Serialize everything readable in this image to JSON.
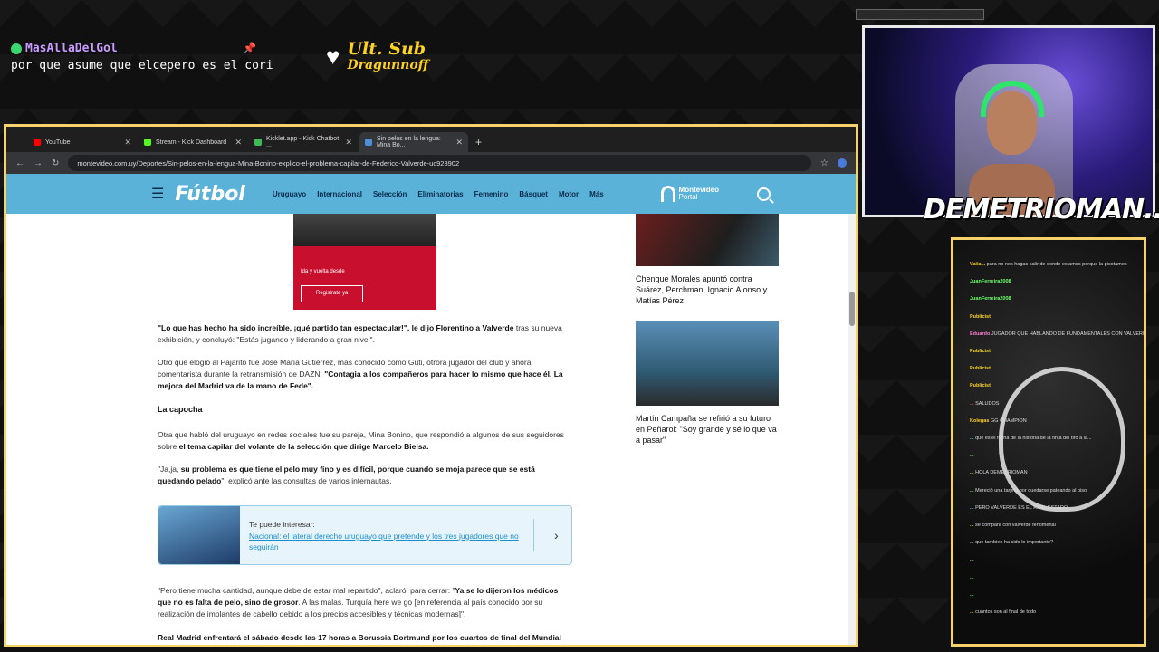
{
  "overlay": {
    "chat_user": "MasAllaDelGol",
    "chat_message": "por que asume que elcepero es el cori",
    "sub_title": "Ult. Sub",
    "sub_name": "Dragunnoff",
    "streamer_name": "DEMETRIOMAN..."
  },
  "browser": {
    "tabs": [
      {
        "label": "YouTube",
        "color": "#ff0000"
      },
      {
        "label": "Stream - Kick Dashboard",
        "color": "#53fc18"
      },
      {
        "label": "Kicklet.app - Kick Chatbot ...",
        "color": "#3cba54"
      },
      {
        "label": "Sin pelos en la lengua: Mina Bo...",
        "color": "#4a90d9"
      }
    ],
    "url": "montevideo.com.uy/Deportes/Sin-pelos-en-la-lengua-Mina-Bonino-explico-el-problema-capilar-de-Federico-Valverde-uc928902"
  },
  "site": {
    "logo": "Fútbol",
    "nav": [
      "Uruguayo",
      "Internacional",
      "Selección",
      "Eliminatorias",
      "Femenino",
      "Básquet",
      "Motor",
      "Más"
    ],
    "portal_line1": "Montevideo",
    "portal_line2": "Portal",
    "ad_text": "Ida y vuelta desde",
    "ad_button": "Registrate ya",
    "p1a": "\"Lo que has hecho ha sido increíble, ¡qué partido tan espectacular!\", le dijo Florentino a Valverde",
    "p1b": " tras su nueva exhibición, y concluyó: \"Estás jugando y liderando a gran nivel\".",
    "p2a": "Otro que elogió al Pajarito fue José María Gutiérrez, más conocido como Guti, otrora jugador del club y ahora comentarista durante la retransmisión de DAZN: ",
    "p2b": "\"Contagia a los compañeros para hacer lo mismo que hace él. La mejora del Madrid va de la mano de Fede\".",
    "heading": "La capocha",
    "p3a": "Otra que habló del uruguayo en redes sociales fue su pareja, Mina Bonino, que respondió a algunos de sus seguidores sobre ",
    "p3b": "el tema capilar del volante de la selección que dirige Marcelo Bielsa.",
    "p4a": "\"Ja,ja, ",
    "p4b": "su problema es que tiene el pelo muy fino y es difícil, porque cuando se moja parece que se está quedando pelado",
    "p4c": "\", explicó ante las consultas de varios internautas.",
    "related_label": "Te puede interesar:",
    "related_link": "Nacional: el lateral derecho uruguayo que pretende y los tres jugadores que no seguirán",
    "p5a": "\"Pero tiene mucha cantidad, aunque debe de estar mal repartido\", aclaró, para cerrar: \"",
    "p5b": "Ya se lo dijeron los médicos que no es falta de pelo, sino de grosor",
    "p5c": ". A las malas. Turquía here we go [en referencia al país conocido por su realización de implantes de cabello debido a los precios accesibles y técnicas modernas]\".",
    "p6": "Real Madrid enfrentará el sábado desde las 17 horas a Borussia Dortmund por los cuartos de final del Mundial en",
    "side1": "Chengue Morales apuntó contra Suárez, Perchman, Ignacio Alonso y Matías Pérez",
    "side2": "Martín Campaña se refirió a su futuro en Peñarol: \"Soy grande y sé lo que va a pasar\""
  },
  "chat": [
    {
      "user": "Vaiia...",
      "text": "para no nos hagas salir de donde estamos porque la picotamos",
      "color": "#ffd21f"
    },
    {
      "user": "JuanFerreira2008",
      "text": "",
      "color": "#6cff6c"
    },
    {
      "user": "JuanFerreira2008",
      "text": "",
      "color": "#6cff6c"
    },
    {
      "user": "Publicist",
      "text": "",
      "color": "#ffd21f"
    },
    {
      "user": "Eduardo",
      "text": "JUGADOR QUE HABLANDO DE FUNDAMENTALES CON VALVERDE DE CAPACIDAD",
      "color": "#ff7bd5"
    },
    {
      "user": "Publicist",
      "text": "",
      "color": "#ffd21f"
    },
    {
      "user": "Publicist",
      "text": "",
      "color": "#ffd21f"
    },
    {
      "user": "Publicist",
      "text": "",
      "color": "#ffd21f"
    },
    {
      "user": "...",
      "text": "SALUDOS",
      "color": "#ff5555"
    },
    {
      "user": "Kolegas",
      "text": "GG CHAMPION",
      "color": "#ffd21f"
    },
    {
      "user": "...",
      "text": "que es el fecha de la historia de la finta del tiro a la...",
      "color": "#6cc7ff"
    },
    {
      "user": "...",
      "text": "",
      "color": "#6cff6c"
    },
    {
      "user": "...",
      "text": "HOLA DEMETRIOMAN",
      "color": "#ffd21f"
    },
    {
      "user": "...",
      "text": "Mereció una tarjeta por quedarse pateando al piso",
      "color": "#6cff6c"
    },
    {
      "user": "...",
      "text": "PERO VALVERDE ES EL REAL ESTADO",
      "color": "#6cc7ff"
    },
    {
      "user": "...",
      "text": "se compara con valverde fenomenal",
      "color": "#ffd21f"
    },
    {
      "user": "...",
      "text": "que tambien ha sido lo importante?",
      "color": "#c79bff"
    },
    {
      "user": "...",
      "text": "",
      "color": "#6cff6c"
    },
    {
      "user": "...",
      "text": "",
      "color": "#6cff6c"
    },
    {
      "user": "...",
      "text": "",
      "color": "#6cff6c"
    },
    {
      "user": "...",
      "text": "cuantos son al final de todo",
      "color": "#ffd21f"
    }
  ]
}
